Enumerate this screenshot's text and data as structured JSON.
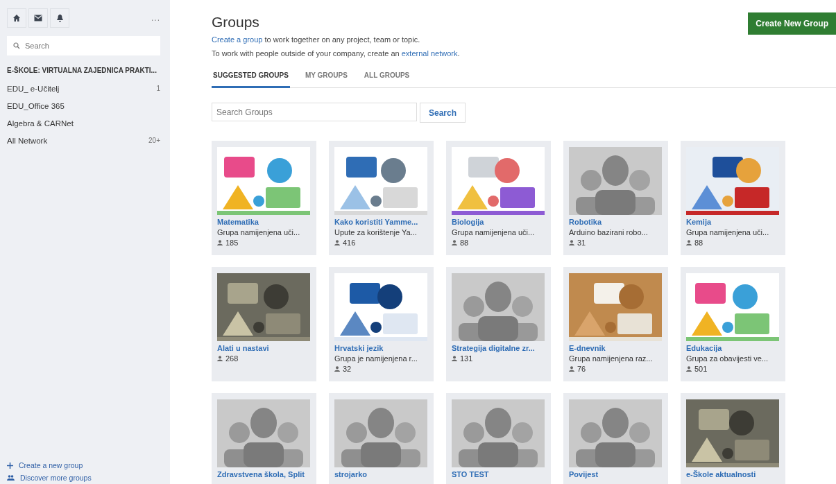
{
  "sidebar": {
    "search": {
      "placeholder": "Search"
    },
    "more": "...",
    "network": "E-ŠKOLE: VIRTUALNA ZAJEDNICA PRAKTI...",
    "items": [
      {
        "label": "EDU_ e-Učitelj",
        "count": "1"
      },
      {
        "label": "EDU_Office 365"
      },
      {
        "label": "Algebra & CARNet"
      },
      {
        "label": "All Network",
        "count": "20+"
      }
    ],
    "footer": [
      {
        "kind": "create",
        "label": "Create a new group"
      },
      {
        "kind": "discover",
        "label": "Discover more groups"
      }
    ]
  },
  "page": {
    "title": "Groups",
    "create_button": "Create New Group",
    "intro": [
      {
        "link": "Create a group",
        "text": " to work together on any project, team or topic."
      },
      {
        "text": "To work with people outside of your company, create an ",
        "link": "external network",
        "after": "."
      }
    ],
    "tabs": [
      {
        "label": "SUGGESTED GROUPS",
        "selected": true
      },
      {
        "label": "MY GROUPS",
        "selected": false
      },
      {
        "label": "ALL GROUPS",
        "selected": false
      }
    ],
    "search": {
      "placeholder": "Search Groups",
      "button": "Search"
    }
  },
  "groups": [
    {
      "name": "Matematika",
      "description": "Grupa namijenjena uči...",
      "members": "185",
      "kind": "picture"
    },
    {
      "name": "Kako koristiti Yamme...",
      "description": "Upute za korištenje Ya...",
      "members": "416",
      "kind": "picture"
    },
    {
      "name": "Biologija",
      "description": "Grupa namijenjena uči...",
      "members": "88",
      "kind": "picture"
    },
    {
      "name": "Robotika",
      "description": "Arduino bazirani robo...",
      "members": "31",
      "kind": "avatar"
    },
    {
      "name": "Kemija",
      "description": "Grupa namijenjena uči...",
      "members": "88",
      "kind": "picture"
    },
    {
      "name": "Alati u nastavi",
      "members": "268",
      "kind": "picture"
    },
    {
      "name": "Hrvatski jezik",
      "description": "Grupa je namijenjena r...",
      "members": "32",
      "kind": "picture"
    },
    {
      "name": "Strategija digitalne zr...",
      "members": "131",
      "kind": "avatar"
    },
    {
      "name": "E-dnevnik",
      "description": "Grupa namijenjena raz...",
      "members": "76",
      "kind": "picture"
    },
    {
      "name": "Edukacija",
      "description": "Grupa za obavijesti ve...",
      "members": "501",
      "kind": "picture"
    },
    {
      "name": "Zdravstvena škola, Split",
      "kind": "avatar"
    },
    {
      "name": "strojarko",
      "kind": "avatar"
    },
    {
      "name": "STO TEST",
      "kind": "avatar"
    },
    {
      "name": "Povijest",
      "kind": "avatar"
    },
    {
      "name": "e-Škole aktualnosti",
      "kind": "picture"
    }
  ]
}
